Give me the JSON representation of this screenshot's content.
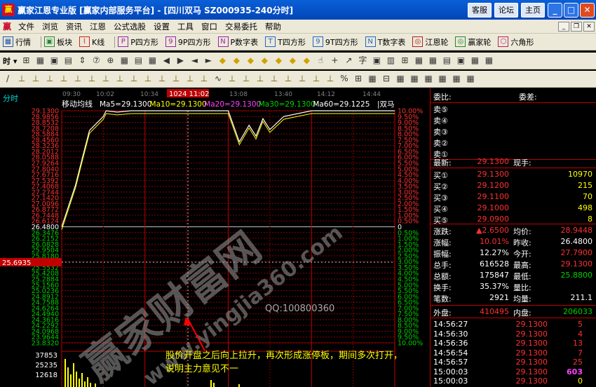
{
  "window": {
    "title": "赢家江恩专业版 [赢家内部服务平台] - [四川双马  SZ000935-240分时]",
    "buttons": [
      "客服",
      "论坛",
      "主页"
    ],
    "controls": [
      "minimize",
      "maximize",
      "close"
    ]
  },
  "menu": {
    "logo": "赢",
    "items": [
      "文件",
      "浏览",
      "资讯",
      "江恩",
      "公式选股",
      "设置",
      "工具",
      "窗口",
      "交易委托",
      "帮助"
    ]
  },
  "toolbar1": [
    {
      "icon": "grid-icon",
      "label": "行情"
    },
    {
      "icon": "blocks-icon",
      "label": "板块"
    },
    {
      "icon": "kline-icon",
      "label": "K线"
    },
    {
      "icon": "p-box-icon",
      "label": "P四方形"
    },
    {
      "icon": "9p-box-icon",
      "label": "9P四方形"
    },
    {
      "icon": "pn-box-icon",
      "label": "P数字表"
    },
    {
      "icon": "t-box-icon",
      "label": "T四方形"
    },
    {
      "icon": "9t-box-icon",
      "label": "9T四方形"
    },
    {
      "icon": "tn-box-icon",
      "label": "T数字表"
    },
    {
      "icon": "wheel-icon",
      "label": "江恩轮"
    },
    {
      "icon": "wheel-icon",
      "label": "赢家轮"
    },
    {
      "icon": "hexagon-icon",
      "label": "六角形"
    }
  ],
  "toolbar2": {
    "period": "时",
    "glyphs": [
      "⊞",
      "▦",
      "▣",
      "▤",
      "⇕",
      "⑦",
      "⊕",
      "▦",
      "▤",
      "▦",
      "◀",
      "▶",
      "◄",
      "►",
      "◆",
      "◆",
      "◆",
      "◆",
      "◆",
      "◆",
      "◆",
      "☝",
      "+",
      "↗",
      "字",
      "▣",
      "▥",
      "⊞",
      "▦",
      "▦",
      "▤",
      "▣",
      "▦",
      "▦"
    ]
  },
  "toolbar3": {
    "glyphs": [
      "/",
      "⊥",
      "⊥",
      "⊥",
      "⊥",
      "⊥",
      "⊥",
      "⊥",
      "⊥",
      "⊥",
      "⊥",
      "⊥",
      "⊥",
      "⊥",
      "⊥",
      "∿",
      "⊥",
      "⊥",
      "⊥",
      "⊥",
      "⊥",
      "⊥",
      "⊥",
      "⊥",
      "%",
      "⊞",
      "▦",
      "⊟",
      "▦",
      "▦",
      "▦",
      "▦",
      "▦",
      "▦"
    ]
  },
  "chart": {
    "label": "分时",
    "ma_title": "移动均线",
    "ma": [
      {
        "label": "Ma5=29.1300",
        "color": "#ffffff"
      },
      {
        "label": "Ma10=29.1300",
        "color": "#ffff00"
      },
      {
        "label": "Ma20=29.1300",
        "color": "#ff40ff"
      },
      {
        "label": "Ma30=29.1300",
        "color": "#00d000"
      },
      {
        "label": "Ma60=29.1225",
        "color": "#ffffff"
      }
    ],
    "stock_name": "双马",
    "time_labels": [
      "09:30",
      "10:02",
      "10:34",
      "1024 11:02",
      "13:08",
      "13:40",
      "14:12",
      "14:44"
    ],
    "cursor_price": "25.6935",
    "price_labels": [
      "29.1300",
      "28.9856",
      "28.8532",
      "28.7208",
      "28.5884",
      "28.4560",
      "28.3236",
      "28.2012",
      "28.0588",
      "27.9264",
      "27.8040",
      "27.6716",
      "27.5392",
      "27.4068",
      "27.2744",
      "27.1420",
      "27.0096",
      "26.8772",
      "26.7448",
      "26.6124",
      "26.4800",
      "26.3476",
      "26.2152",
      "26.0828",
      "25.9504",
      "25.8180",
      "25.6856",
      "25.5532",
      "25.4208",
      "25.2884",
      "25.1560",
      "25.0236",
      "24.8912",
      "24.7588",
      "24.6264",
      "24.4940",
      "24.3616",
      "24.2292",
      "24.0968",
      "23.9644",
      "23.8320"
    ],
    "pct_labels": [
      "10.00%",
      "9.50%",
      "9.00%",
      "8.50%",
      "8.00%",
      "7.50%",
      "7.00%",
      "6.50%",
      "6.00%",
      "5.50%",
      "5.00%",
      "4.50%",
      "4.00%",
      "3.50%",
      "3.00%",
      "2.50%",
      "2.00%",
      "1.50%",
      "1.00%",
      "0.50%",
      "0",
      "0.50%",
      "1.00%",
      "1.50%",
      "2.00%",
      "2.50%",
      "3.00%",
      "3.50%",
      "4.00%",
      "4.50%",
      "5.00%",
      "5.50%",
      "6.00%",
      "6.50%",
      "7.00%",
      "7.50%",
      "8.00%",
      "8.50%",
      "9.00%",
      "9.50%",
      "10.00%"
    ],
    "volume_labels": [
      "37853",
      "25235",
      "12618"
    ],
    "watermark": [
      "赢家财富网",
      "www.yingjia360.com"
    ],
    "qq": "QQ:100800360",
    "annotation_lines": [
      "股价开盘之后向上拉升，再次形成涨停板，期间多次打开，",
      "说明主力意见不一"
    ]
  },
  "chart_data": {
    "type": "line",
    "x": [
      "09:30",
      "09:40",
      "09:45",
      "09:50",
      "10:00",
      "10:02",
      "10:10",
      "10:20",
      "10:34",
      "11:02",
      "11:20",
      "11:30",
      "13:00",
      "13:08",
      "13:15",
      "13:20",
      "13:25",
      "13:30",
      "13:40",
      "14:00",
      "14:12",
      "14:44",
      "15:00"
    ],
    "series": [
      {
        "values": [
          26.48,
          27.44,
          28.07,
          28.68,
          29.0,
          29.13,
          29.1,
          29.13,
          29.13,
          29.13,
          29.13,
          29.13,
          29.13,
          28.42,
          28.8,
          28.55,
          28.95,
          28.7,
          29.0,
          29.13,
          29.13,
          29.13,
          29.13
        ]
      }
    ],
    "ylim": [
      23.832,
      29.13
    ],
    "prev_close": 26.48,
    "grid": true
  },
  "quote": {
    "weibi_label": "委比:",
    "weicha_label": "委差:",
    "sell": [
      {
        "label": "卖⑤"
      },
      {
        "label": "卖④"
      },
      {
        "label": "卖③"
      },
      {
        "label": "卖②"
      },
      {
        "label": "卖①"
      }
    ],
    "latest_label": "最新:",
    "latest": "29.1300",
    "now_vol_label": "现手:",
    "buy": [
      {
        "label": "买①",
        "price": "29.1300",
        "vol": "10970"
      },
      {
        "label": "买②",
        "price": "29.1200",
        "vol": "215"
      },
      {
        "label": "买③",
        "price": "29.1100",
        "vol": "70"
      },
      {
        "label": "买④",
        "price": "29.1000",
        "vol": "498"
      },
      {
        "label": "买⑤",
        "price": "29.0900",
        "vol": "8"
      }
    ],
    "stats": [
      {
        "l1": "涨跌:",
        "v1": "▲2.6500",
        "l2": "均价:",
        "v2": "28.9448",
        "c1": "r",
        "c2": "r"
      },
      {
        "l1": "涨幅:",
        "v1": "10.01%",
        "l2": "昨收:",
        "v2": "26.4800",
        "c1": "r",
        "c2": "w"
      },
      {
        "l1": "振幅:",
        "v1": "12.27%",
        "l2": "今开:",
        "v2": "27.7900",
        "c1": "w",
        "c2": "r"
      },
      {
        "l1": "总手:",
        "v1": "616528",
        "l2": "最高:",
        "v2": "29.1300",
        "c1": "w",
        "c2": "r"
      },
      {
        "l1": "总额:",
        "v1": "175847",
        "l2": "最低:",
        "v2": "25.8800",
        "c1": "w",
        "c2": "g"
      },
      {
        "l1": "换手:",
        "v1": "35.37%",
        "l2": "量比:",
        "v2": "",
        "c1": "w",
        "c2": "w"
      },
      {
        "l1": "笔数:",
        "v1": "2921",
        "l2": "均量:",
        "v2": "211.1",
        "c1": "w",
        "c2": "w"
      }
    ],
    "waipan_label": "外盘:",
    "waipan": "410495",
    "neipan_label": "内盘:",
    "neipan": "206033",
    "ticks": [
      {
        "t": "14:56:27",
        "p": "29.1300",
        "v": "5"
      },
      {
        "t": "14:56:30",
        "p": "29.1300",
        "v": "4"
      },
      {
        "t": "14:56:36",
        "p": "29.1300",
        "v": "13"
      },
      {
        "t": "14:56:54",
        "p": "29.1300",
        "v": "7"
      },
      {
        "t": "14:56:57",
        "p": "29.1300",
        "v": "25"
      },
      {
        "t": "15:00:03",
        "p": "29.1300",
        "v": "603"
      },
      {
        "t": "15:00:03",
        "p": "29.1300",
        "v": "0"
      }
    ]
  }
}
